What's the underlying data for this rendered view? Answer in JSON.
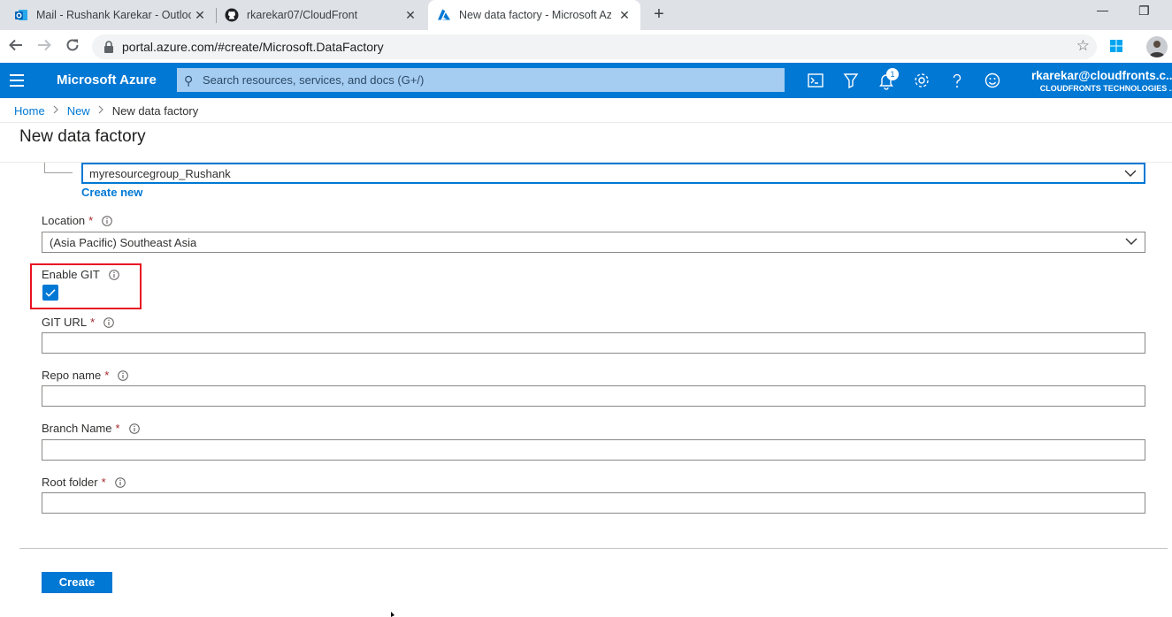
{
  "browser": {
    "tabs": [
      {
        "title": "Mail - Rushank Karekar - Outlook",
        "icon": "outlook-icon"
      },
      {
        "title": "rkarekar07/CloudFront",
        "icon": "github-icon"
      },
      {
        "title": "New data factory - Microsoft Azure",
        "icon": "azure-icon",
        "active": true
      }
    ],
    "close_glyph": "✕",
    "new_tab_glyph": "+",
    "window_controls": {
      "minimize": "—",
      "restore": "❐"
    },
    "url": "portal.azure.com/#create/Microsoft.DataFactory",
    "bookmark_glyph": "☆"
  },
  "azure": {
    "brand": "Microsoft Azure",
    "search_placeholder": "Search resources, services, and docs (G+/)",
    "notification_count": "1",
    "account_email": "rkarekar@cloudfronts.c...",
    "account_org": "CLOUDFRONTS TECHNOLOGIES ...",
    "accent": "#0078d4"
  },
  "breadcrumb": {
    "home": "Home",
    "new": "New",
    "current": "New data factory",
    "separator": ">"
  },
  "page": {
    "title": "New data factory"
  },
  "form": {
    "resource_group": {
      "value": "myresourcegroup_Rushank",
      "create_new": "Create new"
    },
    "location": {
      "label": "Location",
      "required": "*",
      "value": "(Asia Pacific) Southeast Asia"
    },
    "enable_git": {
      "label": "Enable GIT",
      "checked": true
    },
    "git_url": {
      "label": "GIT URL",
      "required": "*",
      "value": ""
    },
    "repo_name": {
      "label": "Repo name",
      "required": "*",
      "value": ""
    },
    "branch_name": {
      "label": "Branch Name",
      "required": "*",
      "value": ""
    },
    "root_folder": {
      "label": "Root folder",
      "required": "*",
      "value": ""
    },
    "create_button": "Create"
  }
}
